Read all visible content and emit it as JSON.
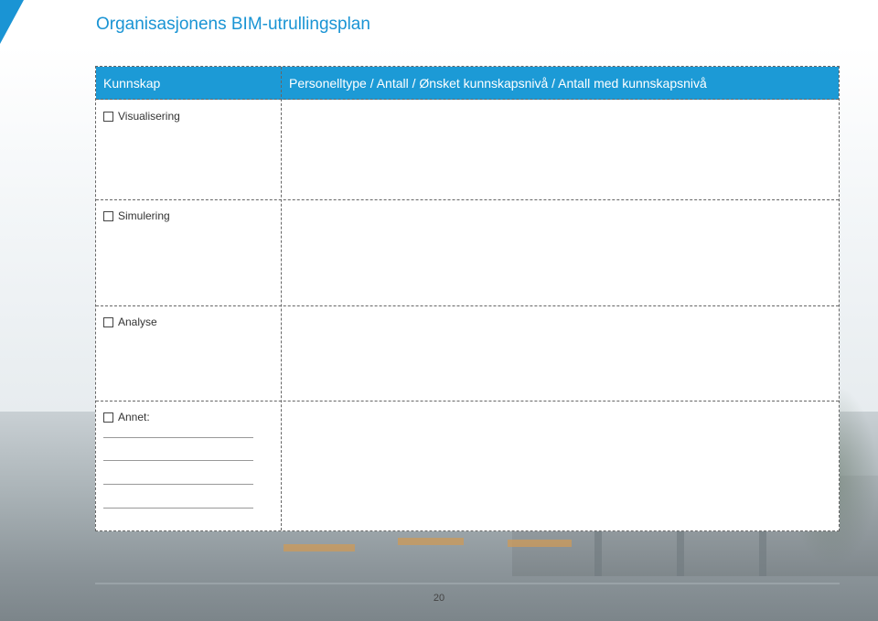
{
  "title": "Organisasjonens BIM-utrullingsplan",
  "table": {
    "header_left": "Kunnskap",
    "header_right": "Personelltype / Antall / Ønsket kunnskapsnivå / Antall med kunnskapsnivå",
    "rows": [
      {
        "label": "Visualisering"
      },
      {
        "label": "Simulering"
      },
      {
        "label": "Analyse"
      },
      {
        "label": "Annet:"
      }
    ]
  },
  "page_number": "20",
  "colors": {
    "accent": "#1a94d4",
    "header_bg": "#1c9ad6"
  }
}
